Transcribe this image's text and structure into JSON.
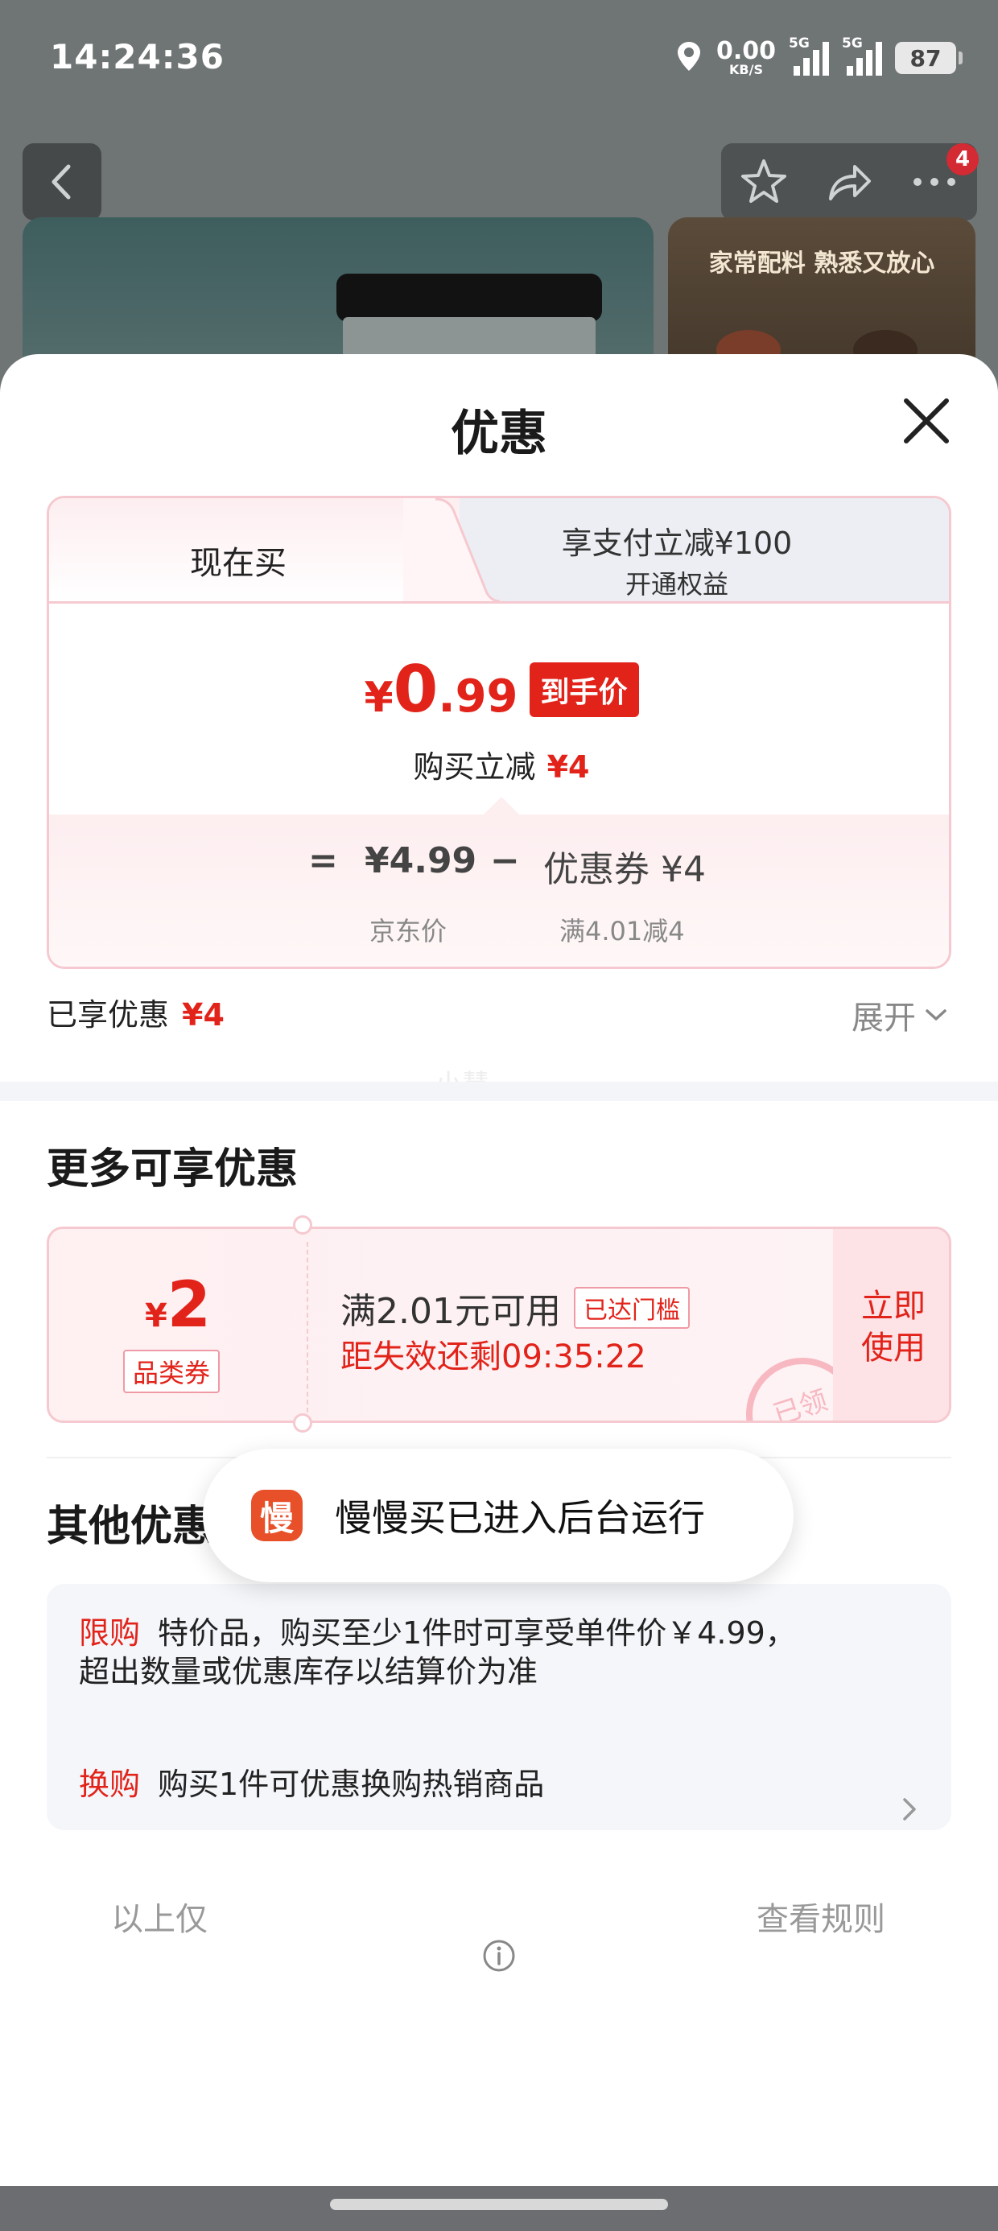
{
  "status_bar": {
    "time": "14:24:36",
    "net_speed_value": "0.00",
    "net_speed_unit": "KB/S",
    "sim1_label": "5G",
    "sim2_label": "5G",
    "battery": "87"
  },
  "product_page": {
    "cart_badge": "4",
    "thumb_title": "家常配料 熟悉又放心"
  },
  "sheet": {
    "title": "优惠",
    "tabs": {
      "now_buy": "现在买",
      "pay_title": "享支付立减¥100",
      "pay_sub": "开通权益"
    },
    "hand_price": {
      "currency": "¥",
      "integer": "0",
      "decimal": ".99",
      "tag": "到手价"
    },
    "reduce": {
      "label": "购买立减",
      "amount": "¥4"
    },
    "calc": {
      "equals": "=",
      "jd_price": "¥4.99",
      "minus": "−",
      "coupon": "优惠券 ¥4",
      "jd_price_label": "京东价",
      "coupon_cond": "满4.01减4"
    },
    "enjoyed": {
      "label": "已享优惠",
      "amount": "¥4"
    },
    "expand_label": "展开",
    "watermark": "小慧",
    "more_title": "更多可享优惠",
    "coupon": {
      "currency": "¥",
      "amount": "2",
      "type": "品类券",
      "condition": "满2.01元可用",
      "status_tag": "已达门槛",
      "countdown": "距失效还剩09:35:22",
      "use_line1": "立即",
      "use_line2": "使用",
      "stamp": "已领"
    },
    "other_title": "其他优惠",
    "other": [
      {
        "tag": "限购",
        "text_line1": "特价品，购买至少1件时可享受单件价￥4.99，",
        "text_line2": "超出数量或优惠库存以结算价为准"
      },
      {
        "tag": "换购",
        "text_line1": "购买1件可优惠换购热销商品"
      }
    ],
    "rules_left": "以上仅",
    "rules_right": "查看规则"
  },
  "toast": {
    "logo_char": "慢",
    "text": "慢慢买已进入后台运行"
  },
  "colors": {
    "accent_red": "#e2231a",
    "toast_logo": "#e8502a"
  },
  "icons": [
    "location-icon",
    "back-chevron-icon",
    "star-icon",
    "share-icon",
    "more-icon",
    "close-icon",
    "chevron-down-icon",
    "chevron-right-icon",
    "info-icon"
  ]
}
